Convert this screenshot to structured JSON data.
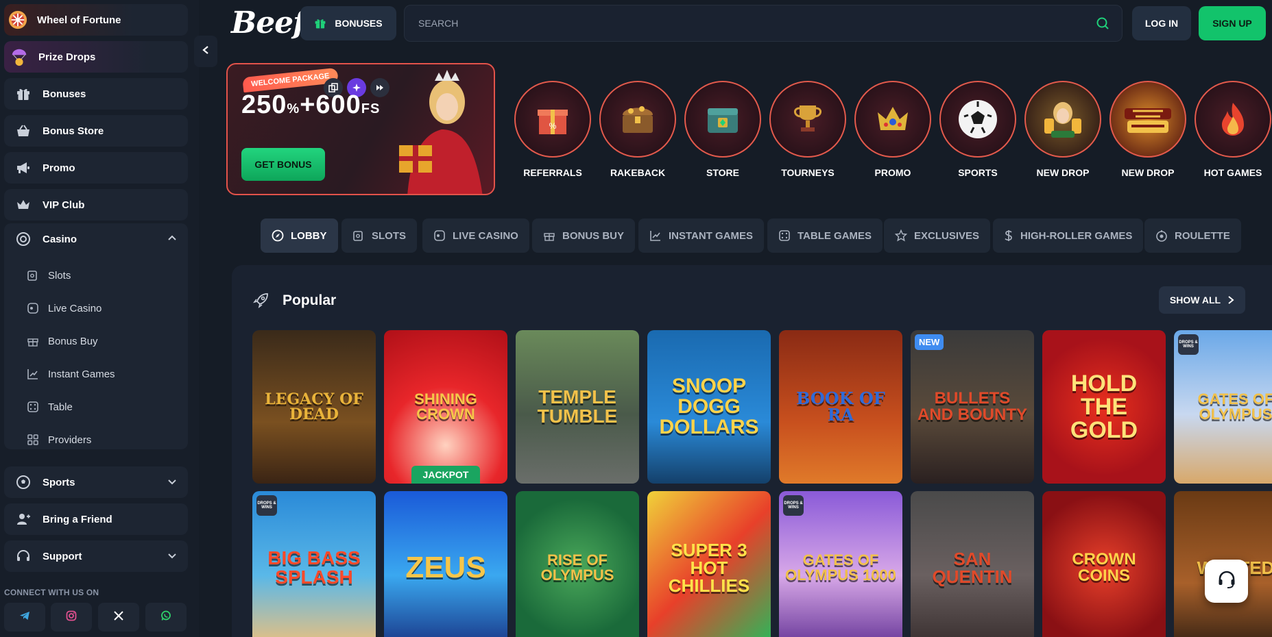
{
  "sidebar": {
    "wheel_label": "Wheel of Fortune",
    "prize_label": "Prize Drops",
    "bonuses_label": "Bonuses",
    "bonus_store_label": "Bonus Store",
    "promo_label": "Promo",
    "vip_label": "VIP Club",
    "casino_label": "Casino",
    "casino_items": [
      "Slots",
      "Live Casino",
      "Bonus Buy",
      "Instant Games",
      "Table",
      "Providers"
    ],
    "sports_label": "Sports",
    "friend_label": "Bring a Friend",
    "support_label": "Support",
    "connect_label": "CONNECT WITH US ON",
    "social_icons": [
      "telegram-icon",
      "instagram-icon",
      "x-icon",
      "whatsapp-icon"
    ]
  },
  "header": {
    "logo": "Beef",
    "bonuses_label": "BONUSES",
    "search_placeholder": "SEARCH",
    "login_label": "LOG IN",
    "signup_label": "SIGN UP"
  },
  "banner": {
    "tag": "WELCOME PACKAGE",
    "amount_main": "250",
    "amount_pct": "%",
    "amount_plus": "+600",
    "amount_fs": "FS",
    "cta": "GET BONUS"
  },
  "shortcuts": [
    "REFERRALS",
    "RAKEBACK",
    "STORE",
    "TOURNEYS",
    "PROMO",
    "SPORTS",
    "NEW DROP",
    "NEW DROP",
    "HOT GAMES"
  ],
  "tabs": [
    "LOBBY",
    "SLOTS",
    "LIVE CASINO",
    "BONUS BUY",
    "INSTANT GAMES",
    "TABLE GAMES",
    "EXCLUSIVES",
    "HIGH-ROLLER GAMES",
    "ROULETTE"
  ],
  "popular": {
    "title": "Popular",
    "show_all": "SHOW ALL",
    "badge_new": "NEW",
    "badge_jackpot": "JACKPOT",
    "badge_drops": "DROPS & WINS",
    "row1": [
      "LEGACY OF DEAD",
      "SHINING CROWN",
      "TEMPLE TUMBLE",
      "SNOOP DOGG DOLLARS",
      "BOOK OF RA",
      "BULLETS AND BOUNTY",
      "HOLD THE GOLD",
      "GATES OF OLYMPUS"
    ],
    "row2": [
      "BIG BASS SPLASH",
      "ZEUS",
      "RISE OF OLYMPUS",
      "SUPER 3 HOT CHILLIES",
      "GATES OF OLYMPUS 1000",
      "SAN QUENTIN",
      "CROWN COINS",
      "WANTED"
    ]
  },
  "colors": {
    "accent_green": "#12c36b",
    "accent_red": "#e3534a",
    "background": "#151c26",
    "panel": "#1a2230"
  }
}
